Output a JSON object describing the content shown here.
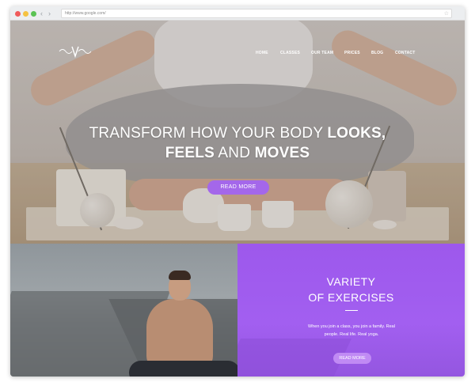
{
  "browser": {
    "url": "http://www.google.com/",
    "back_icon": "chevron-left-icon",
    "forward_icon": "chevron-right-icon",
    "url_action_icon": "bookmark-icon"
  },
  "nav": {
    "logo": "logo",
    "items": [
      {
        "label": "HOME"
      },
      {
        "label": "CLASSES"
      },
      {
        "label": "OUR TEAM"
      },
      {
        "label": "PRICES"
      },
      {
        "label": "BLOG"
      },
      {
        "label": "CONTACT"
      }
    ]
  },
  "hero": {
    "line1_plain": "TRANSFORM HOW YOUR BODY",
    "line1_bold": "LOOKS,",
    "line2_bold_a": "FEELS",
    "line2_plain": "AND",
    "line2_bold_b": "MOVES",
    "button_label": "READ MORE"
  },
  "feature": {
    "title_line1": "VARIETY",
    "title_line2": "OF EXERCISES",
    "text": "When you join a class, you join a family. Real people. Real life. Real yoga.",
    "button_label": "READ MORE"
  },
  "colors": {
    "accent": "#a467ea",
    "purple_panel": "#9d58ec"
  }
}
